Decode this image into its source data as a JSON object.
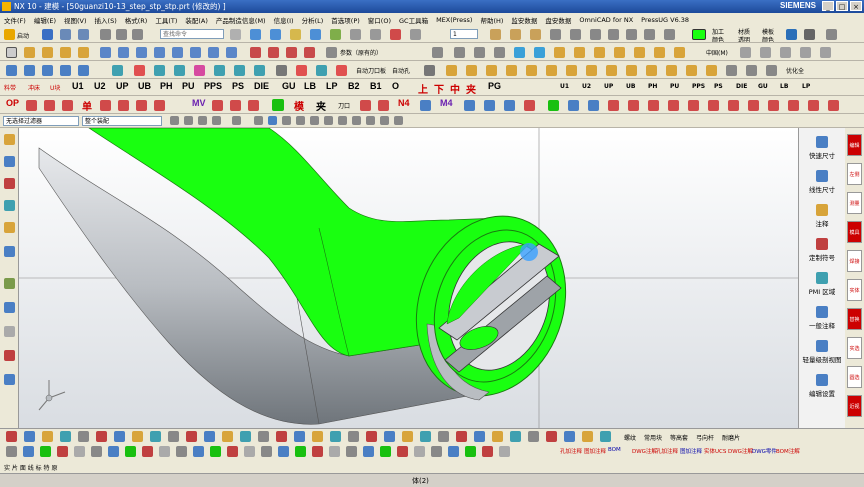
{
  "window": {
    "title": "NX 10 - 建模 - [50guanzi10-13_step_stp_stp.prt  (修改的) ]",
    "brand": "SIEMENS"
  },
  "menu": [
    "文件(F)",
    "编辑(E)",
    "视图(V)",
    "插入(S)",
    "格式(R)",
    "工具(T)",
    "装配(A)",
    "产品制造信息(M)",
    "信息(I)",
    "分析(L)",
    "首选项(P)",
    "窗口(O)",
    "GC工具箱",
    "MEX(Press)",
    "帮助(H)",
    "监安数据",
    "盘安数据",
    "OmniCAD for NX",
    "PressUG V6.38"
  ],
  "toolbar1": {
    "start_label": "启动",
    "search_placeholder": "查找命令",
    "layer_value": "1",
    "add_label": "加工",
    "add_sub": "颜色",
    "material_label": "材质",
    "material_sub": "透明",
    "model_label": "模板",
    "model_sub": "颜色"
  },
  "toolbar2": {
    "param_label": "参数（原有的）",
    "auto_hole_label": "自动刀口板",
    "auto_hole2_label": "自动孔",
    "center_label": "中国(M)",
    "optimize_label": "优化全"
  },
  "toolbar3": {
    "codes": [
      "U1",
      "U2",
      "UP",
      "UB",
      "PH",
      "PU",
      "PPS",
      "PS",
      "DIE",
      "GU",
      "LB",
      "LP",
      "B2",
      "B1",
      "O"
    ],
    "chinese": [
      "上",
      "下",
      "中",
      "夹"
    ],
    "pg_label": "PG"
  },
  "toolbar4": {
    "op_label": "OP",
    "single_label": "单",
    "mv_label": "MV",
    "n4_label": "N4",
    "m4_label": "M4",
    "mold_label": "模",
    "clamp_label": "夹",
    "knife_label": "刀口"
  },
  "filter_bar": {
    "filter_value": "无选择过滤器",
    "assembly_value": "整个装配"
  },
  "right_panel": [
    "快速尺寸",
    "线性尺寸",
    "注释",
    "定制符号",
    "PMI 区域",
    "一般注释",
    "轻量级剖视图",
    "编辑设置"
  ],
  "right_strip": [
    "编辑",
    "左侧",
    "测量",
    "模具",
    "焊接",
    "实体",
    "替换",
    "实选",
    "圆选",
    "近视"
  ],
  "bottom_toolbar": {
    "labels": [
      "螺纹",
      "常用块",
      "等高套",
      "弓向杆",
      "耐磨片"
    ],
    "bottom2": [
      "孔加注释",
      "图加注释",
      "BOM",
      "DWG注解",
      "孔加注释",
      "图加注释",
      "实体UCS",
      "DWG注解",
      "DWG零件",
      "BOM注解"
    ]
  },
  "status": {
    "left": "实 片 面 线 标 特 原",
    "center": "体(2)"
  },
  "colors": {
    "green": "#19ff10",
    "gray_dark": "#7a7f84",
    "gray_light": "#c8cbd0",
    "viewport_top": "#ffffff",
    "viewport_bottom": "#d9dde2"
  }
}
